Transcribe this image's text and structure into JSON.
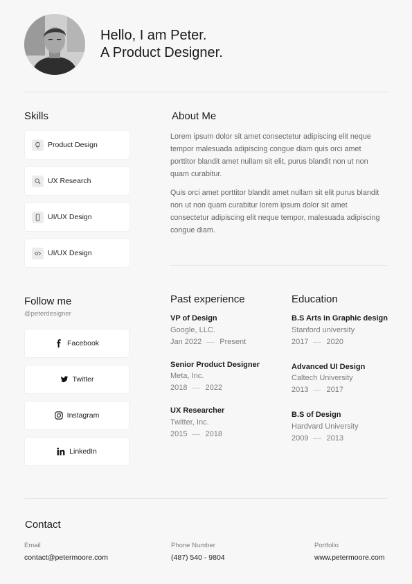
{
  "header": {
    "greeting_line1": "Hello, I am Peter.",
    "greeting_line2": "A Product Designer."
  },
  "skills": {
    "title": "Skills",
    "items": [
      {
        "label": "Product Design",
        "icon": "lightbulb-icon"
      },
      {
        "label": "UX Research",
        "icon": "search-icon"
      },
      {
        "label": "UI/UX Design",
        "icon": "mobile-icon"
      },
      {
        "label": "UI/UX Design",
        "icon": "code-icon"
      }
    ]
  },
  "about": {
    "title": "About Me",
    "paragraph1": "Lorem ipsum dolor sit amet consectetur adipiscing elit neque tempor malesuada adipiscing congue diam quis orci amet porttitor blandit amet nullam sit elit, purus blandit non ut non quam curabitur.",
    "paragraph2": "Quis orci amet porttitor blandit amet nullam sit elit purus blandit non ut non quam curabitur lorem ipsum dolor sit amet consectetur adipiscing elit neque tempor, malesuada adipiscing congue diam."
  },
  "follow": {
    "title": "Follow me",
    "handle": "@peterdesigner",
    "items": [
      {
        "label": "Facebook",
        "icon": "facebook-icon"
      },
      {
        "label": "Twitter",
        "icon": "twitter-icon"
      },
      {
        "label": "Instagram",
        "icon": "instagram-icon"
      },
      {
        "label": "LinkedIn",
        "icon": "linkedin-icon"
      }
    ]
  },
  "experience": {
    "title": "Past experience",
    "items": [
      {
        "title": "VP of Design",
        "org": "Google, LLC.",
        "start": "Jan 2022",
        "end": "Present"
      },
      {
        "title": "Senior Product Designer",
        "org": "Meta, Inc.",
        "start": "2018",
        "end": "2022"
      },
      {
        "title": "UX Researcher",
        "org": "Twitter, Inc.",
        "start": "2015",
        "end": "2018"
      }
    ]
  },
  "education": {
    "title": "Education",
    "items": [
      {
        "title": "B.S Arts in Graphic design",
        "org": "Stanford university",
        "start": "2017",
        "end": "2020"
      },
      {
        "title": "Advanced UI Design",
        "org": "Caltech University",
        "start": "2013",
        "end": "2017"
      },
      {
        "title": "B.S of Design",
        "org": "Hardvard University",
        "start": "2009",
        "end": "2013"
      }
    ]
  },
  "contact": {
    "title": "Contact",
    "email_label": "Email",
    "email": "contact@petermoore.com",
    "phone_label": "Phone Number",
    "phone": "(487) 540 - 9804",
    "portfolio_label": "Portfolio",
    "portfolio": "www.petermoore.com"
  }
}
